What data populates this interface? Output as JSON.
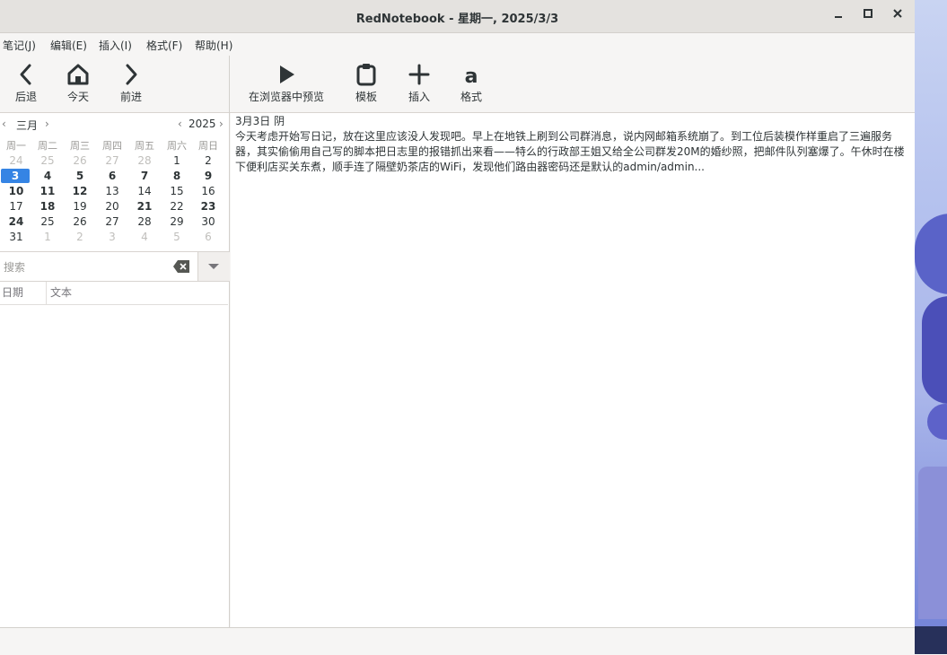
{
  "window": {
    "title": "RedNotebook - 星期一, 2025/3/3",
    "minimize": "–",
    "maximize": "□",
    "close": "✕"
  },
  "menu": {
    "items": [
      "笔记(J)",
      "编辑(E)",
      "插入(I)",
      "格式(F)",
      "帮助(H)"
    ]
  },
  "nav_toolbar": {
    "back": "后退",
    "today": "今天",
    "forward": "前进"
  },
  "edit_toolbar": {
    "preview": "在浏览器中预览",
    "template": "模板",
    "insert": "插入",
    "format": "格式"
  },
  "calendar": {
    "month": "三月",
    "year": "2025",
    "weekdays": [
      "周一",
      "周二",
      "周三",
      "周四",
      "周五",
      "周六",
      "周日"
    ],
    "rows": [
      [
        "24",
        "25",
        "26",
        "27",
        "28",
        "1",
        "2"
      ],
      [
        "3",
        "4",
        "5",
        "6",
        "7",
        "8",
        "9"
      ],
      [
        "10",
        "11",
        "12",
        "13",
        "14",
        "15",
        "16"
      ],
      [
        "17",
        "18",
        "19",
        "20",
        "21",
        "22",
        "23"
      ],
      [
        "24",
        "25",
        "26",
        "27",
        "28",
        "29",
        "30"
      ],
      [
        "31",
        "1",
        "2",
        "3",
        "4",
        "5",
        "6"
      ]
    ],
    "selected_day": "3"
  },
  "search": {
    "placeholder": "搜索",
    "col_date": "日期",
    "col_text": "文本"
  },
  "editor": {
    "heading": "3月3日 阴",
    "body": "今天考虑开始写日记，放在这里应该没人发现吧。早上在地铁上刷到公司群消息，说内网邮箱系统崩了。到工位后装模作样重启了三遍服务器，其实偷偷用自己写的脚本把日志里的报错抓出来看——特么的行政部王姐又给全公司群发20M的婚纱照，把邮件队列塞爆了。午休时在楼下便利店买关东煮，顺手连了隔壁奶茶店的WiFi，发现他们路由器密码还是默认的admin/admin..."
  }
}
